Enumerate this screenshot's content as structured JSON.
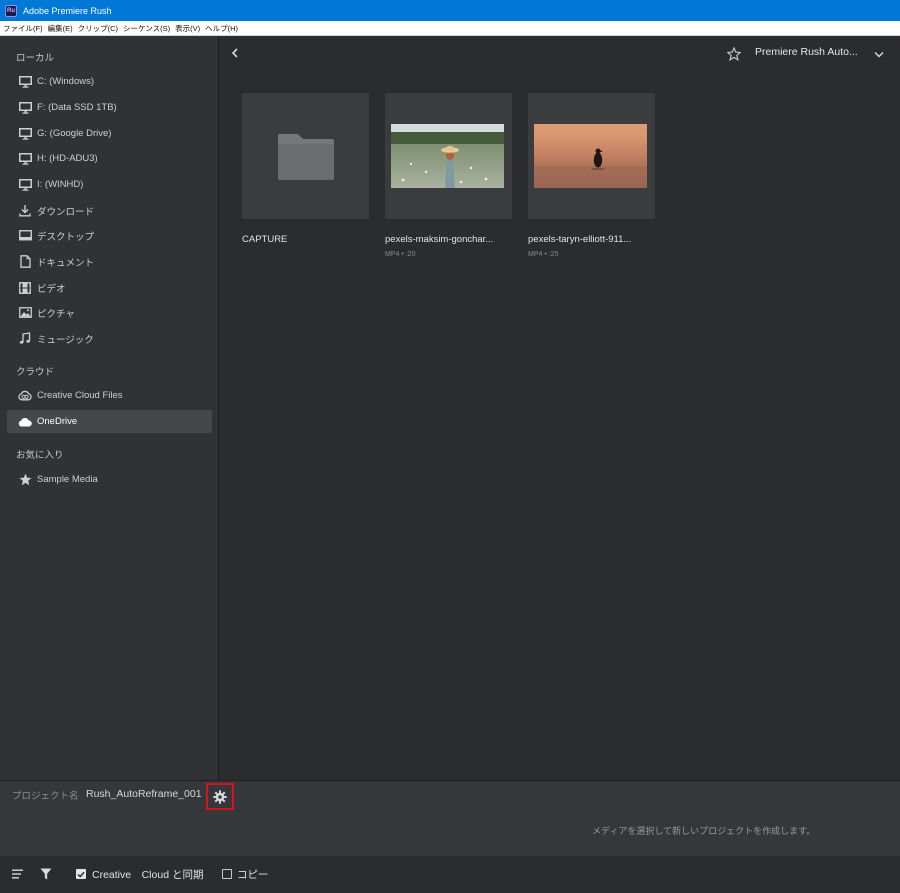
{
  "window": {
    "title": "Adobe Premiere Rush",
    "app_icon_text": "Ru"
  },
  "menu": [
    "ファイル(F)",
    "編集(E)",
    "クリップ(C)",
    "シーケンス(S)",
    "表示(V)",
    "ヘルプ(H)"
  ],
  "sidebar": {
    "local_label": "ローカル",
    "local_items": [
      {
        "label": "C: (Windows)",
        "icon": "monitor-icon"
      },
      {
        "label": "F: (Data SSD 1TB)",
        "icon": "monitor-icon"
      },
      {
        "label": "G: (Google Drive)",
        "icon": "monitor-icon"
      },
      {
        "label": "H: (HD-ADU3)",
        "icon": "monitor-icon"
      },
      {
        "label": "I: (WINHD)",
        "icon": "monitor-icon"
      },
      {
        "label": "ダウンロード",
        "icon": "download-icon"
      },
      {
        "label": "デスクトップ",
        "icon": "desktop-icon"
      },
      {
        "label": "ドキュメント",
        "icon": "document-icon"
      },
      {
        "label": "ビデオ",
        "icon": "film-icon"
      },
      {
        "label": "ピクチャ",
        "icon": "picture-icon"
      },
      {
        "label": "ミュージック",
        "icon": "music-note-icon"
      }
    ],
    "cloud_label": "クラウド",
    "cloud_items": [
      {
        "label": "Creative Cloud Files",
        "icon": "creative-cloud-icon"
      },
      {
        "label": "OneDrive",
        "icon": "cloud-icon",
        "active": true
      }
    ],
    "favorites_label": "お気に入り",
    "favorite_items": [
      {
        "label": "Sample Media",
        "icon": "star-filled-icon"
      }
    ]
  },
  "browser": {
    "location": "Premiere Rush Auto...",
    "items": [
      {
        "name": "CAPTURE",
        "type": "folder",
        "meta": ""
      },
      {
        "name": "pexels-maksim-gonchar...",
        "type": "video",
        "meta": "MP4 • :20"
      },
      {
        "name": "pexels-taryn-elliott-911...",
        "type": "video",
        "meta": "MP4 • :25"
      }
    ]
  },
  "project": {
    "label": "プロジェクト名",
    "name": "Rush_AutoReframe_001",
    "hint": "メディアを選択して新しいプロジェクトを作成します。"
  },
  "footer": {
    "sync_label": "Creative　Cloud と同期",
    "sync_checked": true,
    "copy_label": "コピー",
    "copy_checked": false
  },
  "colors": {
    "titlebar": "#0078d7",
    "highlight_border": "#d7141b",
    "active_item": "#46474a"
  }
}
